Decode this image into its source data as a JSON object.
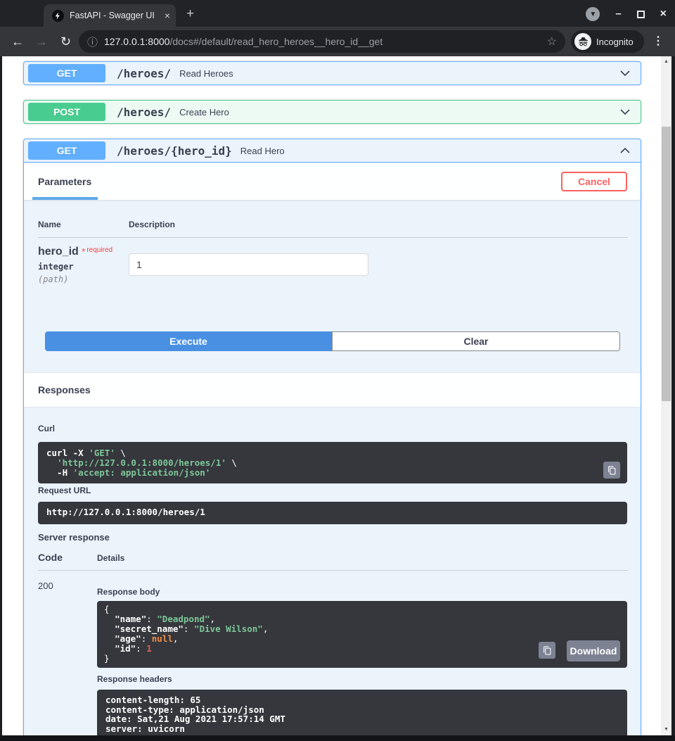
{
  "browser": {
    "tab_title": "FastAPI - Swagger UI",
    "url_host": "127.0.0.1:8000",
    "url_path": "/docs#/default/read_hero_heroes__hero_id__get",
    "incognito_label": "Incognito"
  },
  "icons": {
    "tab_close": "×",
    "new_tab": "+",
    "back": "←",
    "forward": "→",
    "reload": "↻",
    "info": "ⓘ",
    "star": "☆",
    "menu": "⋮",
    "update_caret": "▼",
    "minimize": "–",
    "window_close": "×",
    "scroll_up": "▲",
    "scroll_down": "▼",
    "favicon_bolt": "🗲"
  },
  "colors": {
    "get_accent": "#61affe",
    "post_accent": "#49cc90",
    "execute_blue": "#4990e2",
    "cancel_red": "#ff6060",
    "code_block_bg": "#35373c",
    "code_string_green": "#7ec699",
    "code_null_orange": "#f08d49",
    "code_number_red": "#e0615c"
  },
  "endpoints": [
    {
      "method": "GET",
      "path": "/heroes/",
      "summary": "Read Heroes"
    },
    {
      "method": "POST",
      "path": "/heroes/",
      "summary": "Create Hero"
    }
  ],
  "expanded": {
    "method": "GET",
    "path": "/heroes/{hero_id}",
    "summary": "Read Hero",
    "parameters": {
      "tab_label": "Parameters",
      "cancel_label": "Cancel",
      "col_name": "Name",
      "col_description": "Description",
      "param_name": "hero_id",
      "required_star": "*",
      "required_label": "required",
      "param_type": "integer",
      "param_in": "(path)",
      "value": "1"
    },
    "actions": {
      "execute": "Execute",
      "clear": "Clear"
    },
    "responses": {
      "title": "Responses",
      "curl_label": "Curl",
      "curl": {
        "l1a": "curl -X ",
        "l1b": "'GET'",
        "l1c": " \\",
        "l2a": "  ",
        "l2b": "'http://127.0.0.1:8000/heroes/1'",
        "l2c": " \\",
        "l3a": "  -H ",
        "l3b": "'accept: application/json'"
      },
      "request_url_label": "Request URL",
      "request_url": "http://127.0.0.1:8000/heroes/1",
      "server_response_label": "Server response",
      "col_code": "Code",
      "col_details": "Details",
      "status_code": "200",
      "response_body_label": "Response body",
      "body": {
        "open": "{",
        "k_name": "\"name\"",
        "v_name": "\"Deadpond\"",
        "k_secret": "\"secret_name\"",
        "v_secret": "\"Dive Wilson\"",
        "k_age": "\"age\"",
        "v_age": "null",
        "k_id": "\"id\"",
        "v_id": "1",
        "colon": ": ",
        "comma": ",",
        "close": "}"
      },
      "download_label": "Download",
      "response_headers_label": "Response headers",
      "headers": [
        "content-length: 65",
        "content-type: application/json",
        "date: Sat,21 Aug 2021 17:57:14 GMT",
        "server: uvicorn"
      ]
    }
  }
}
